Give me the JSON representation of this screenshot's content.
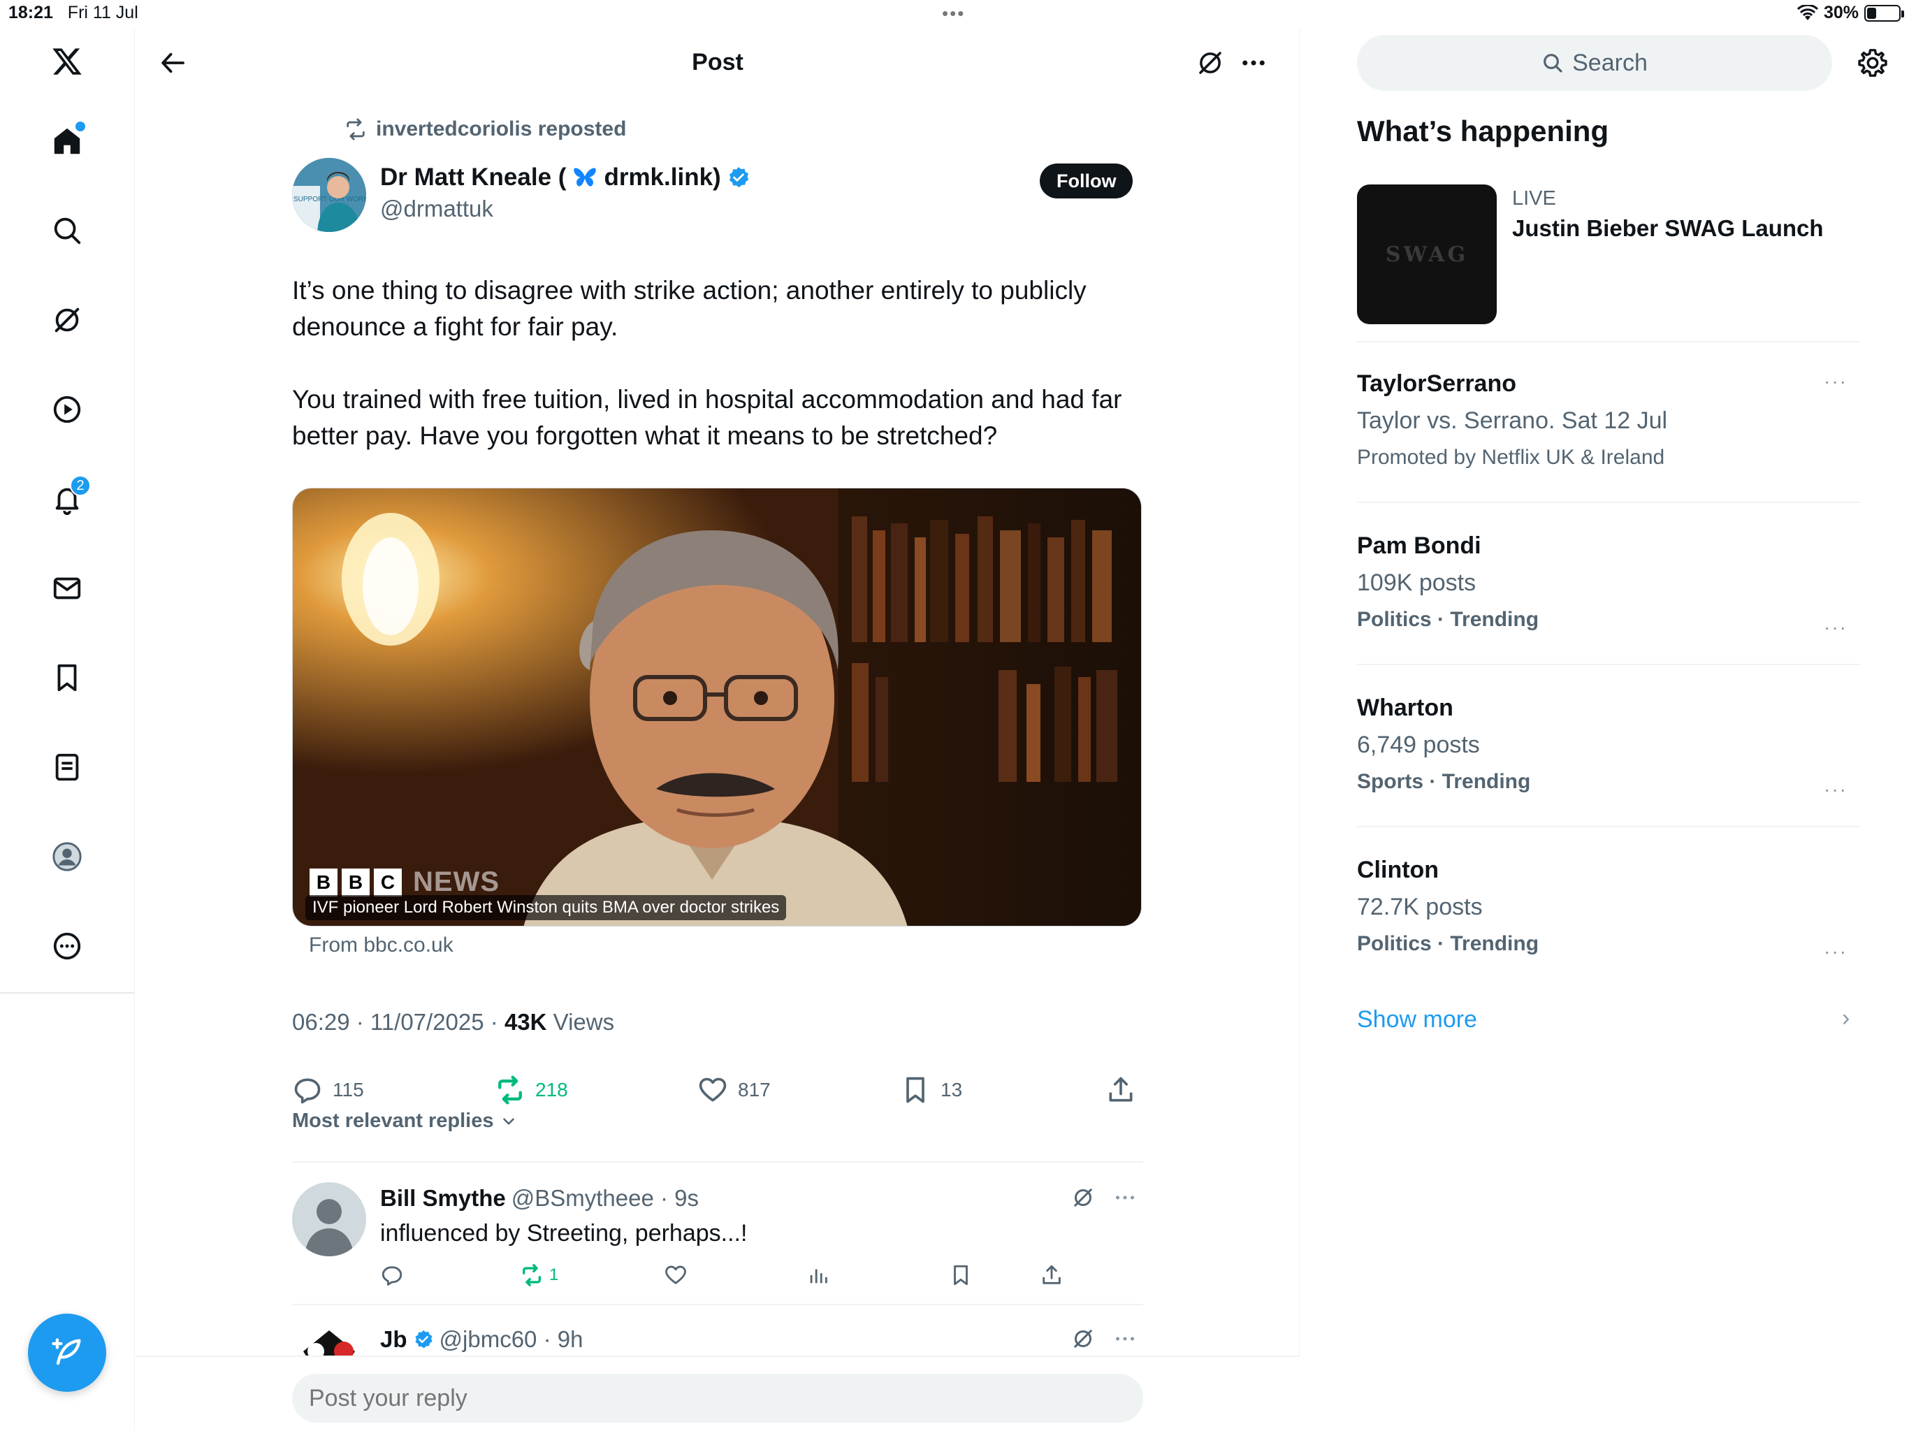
{
  "status_bar": {
    "time": "18:21",
    "date": "Fri 11 Jul",
    "battery": "30%",
    "battery_level": 0.3
  },
  "nav": {
    "notifications_badge": "2",
    "items": [
      "x-logo-icon",
      "home-icon",
      "search-icon",
      "grok-icon",
      "video-icon",
      "notifications-icon",
      "messages-icon",
      "bookmarks-icon",
      "lists-icon",
      "profile-icon",
      "more-icon"
    ]
  },
  "header": {
    "title": "Post"
  },
  "post": {
    "repost_label": "invertedcoriolis reposted",
    "author_name_a": "Dr Matt Kneale (",
    "author_name_b": "drmk.link)",
    "author_handle": "@drmattuk",
    "follow_label": "Follow",
    "paragraph1": "It’s one thing to disagree with strike action; another entirely to publicly denounce a fight for fair pay.",
    "paragraph2": "You trained with free tuition, lived in hospital accommodation and had far better pay. Have you forgotten what it means to be stretched?",
    "media_caption": "IVF pioneer Lord Robert Winston quits BMA over doctor strikes",
    "media_logo_b1": "B",
    "media_logo_b2": "B",
    "media_logo_c": "C",
    "media_logo_news": "NEWS",
    "avatar_sign": "SUPPORT OUR WORK",
    "from_link": "From bbc.co.uk",
    "time_date": "06:29 · 11/07/2025 · ",
    "views_count": "43K",
    "views_label": " Views",
    "replies": "115",
    "reposts": "218",
    "likes": "817",
    "bookmarks": "13"
  },
  "replies_section": {
    "sort_label": "Most relevant replies",
    "items": [
      {
        "name": "Bill Smythe",
        "handle": "@BSmytheee · 9s",
        "text": "influenced by Streeting, perhaps...!",
        "reposts": "1"
      },
      {
        "name": "Jb",
        "handle": "@jbmc60 · 9h"
      }
    ]
  },
  "reply_box": {
    "placeholder": "Post your reply"
  },
  "sidebar": {
    "search_placeholder": "Search",
    "section_title": "What’s happening",
    "live": {
      "label": "LIVE",
      "title": "Justin Bieber SWAG Launch",
      "thumb_text": "SWAG"
    },
    "trends": [
      {
        "title": "TaylorSerrano",
        "line2": "Taylor vs. Serrano. Sat 12 Jul",
        "line3": "Promoted by Netflix UK & Ireland"
      },
      {
        "title": "Pam Bondi",
        "line2": "109K posts",
        "line3": "Politics · Trending"
      },
      {
        "title": "Wharton",
        "line2": "6,749 posts",
        "line3": "Sports · Trending"
      },
      {
        "title": "Clinton",
        "line2": "72.7K posts",
        "line3": "Politics · Trending"
      }
    ],
    "show_more": "Show more",
    "more_dots": "···"
  },
  "colors": {
    "accent": "#1d9bf0",
    "repost_green": "#00ba7c",
    "text": "#0f1419",
    "muted": "#536471"
  }
}
